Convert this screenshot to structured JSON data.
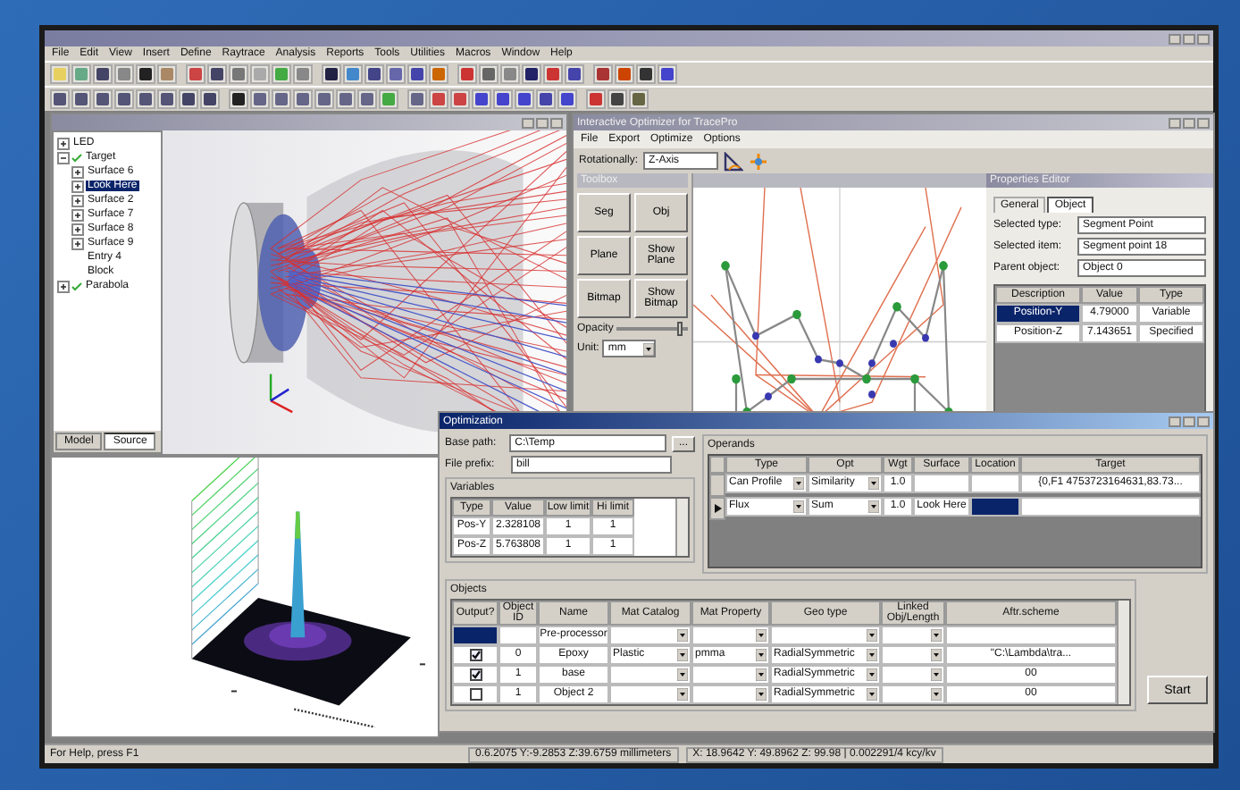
{
  "app": {
    "menu": [
      "File",
      "Edit",
      "View",
      "Insert",
      "Define",
      "Raytrace",
      "Analysis",
      "Reports",
      "Tools",
      "Utilities",
      "Macros",
      "Window",
      "Help"
    ]
  },
  "model_window": {
    "tree": [
      {
        "label": "LED",
        "expanded": false,
        "checked": false,
        "selected": false
      },
      {
        "label": "Target",
        "expanded": true,
        "checked": true,
        "selected": false,
        "children": [
          {
            "label": "Surface 6",
            "expanded": false,
            "selected": false
          },
          {
            "label": "Look Here",
            "expanded": false,
            "selected": true
          },
          {
            "label": "Surface 2",
            "expanded": false,
            "selected": false
          },
          {
            "label": "Surface 7",
            "expanded": false,
            "selected": false
          },
          {
            "label": "Surface 8",
            "expanded": false,
            "selected": false
          },
          {
            "label": "Surface 9",
            "expanded": false,
            "selected": false
          },
          {
            "label": "Entry 4",
            "selected": false
          },
          {
            "label": "Block",
            "selected": false
          }
        ]
      },
      {
        "label": "Parabola",
        "expanded": false,
        "checked": true,
        "selected": false
      }
    ],
    "tabs": [
      {
        "label": "Model",
        "selected": false
      },
      {
        "label": "Source",
        "selected": true
      }
    ]
  },
  "optimizer_window": {
    "title": "Interactive Optimizer for TracePro",
    "menu": [
      "File",
      "Export",
      "Optimize",
      "Options"
    ],
    "rotation": {
      "label": "Rotationally:",
      "value": "Z-Axis"
    },
    "toolbox": {
      "title": "Toolbox",
      "buttons": [
        "Seg",
        "Obj",
        "Plane",
        "Show Plane",
        "Bitmap",
        "Show Bitmap"
      ],
      "opacity": {
        "label": "Opacity",
        "level": 0.9
      },
      "unit": {
        "label": "Unit:",
        "value": "mm"
      }
    },
    "properties": {
      "title": "Properties Editor",
      "tabs": [
        {
          "label": "General",
          "selected": false
        },
        {
          "label": "Object",
          "selected": true
        }
      ],
      "fields": [
        {
          "label": "Selected type:",
          "value": "Segment Point"
        },
        {
          "label": "Selected item:",
          "value": "Segment point 18"
        },
        {
          "label": "Parent object:",
          "value": "Object 0"
        }
      ],
      "columns": [
        "Description",
        "Value",
        "Type"
      ],
      "rows": [
        {
          "cells": [
            "Position-Y",
            "4.79000",
            "Variable"
          ],
          "selected": true
        },
        {
          "cells": [
            "Position-Z",
            "7.143651",
            "Specified"
          ],
          "selected": false
        }
      ]
    }
  },
  "optimization_window": {
    "title": "Optimization",
    "base_path": {
      "label": "Base path:",
      "value": "C:\\Temp",
      "button": "..."
    },
    "file_prefix": {
      "label": "File prefix:",
      "value": "bill"
    },
    "variables": {
      "title": "Variables",
      "columns": [
        "Type",
        "Value",
        "Low limit",
        "Hi limit"
      ],
      "rows": [
        [
          "Pos-Y",
          "2.328108",
          "1",
          "1"
        ],
        [
          "Pos-Z",
          "5.763808",
          "1",
          "1"
        ]
      ]
    },
    "operands": {
      "title": "Operands",
      "columns": [
        "Type",
        "Opt",
        "Wgt",
        "Surface",
        "Location",
        "Target"
      ],
      "rows": [
        {
          "type": "Can Profile",
          "opt": "Similarity",
          "wgt": "1.0",
          "surface": "",
          "target": "{0,F1 4753723164631,83.73...",
          "selected": false
        },
        {
          "type": "Flux",
          "opt": "Sum",
          "wgt": "1.0",
          "surface": "Look Here",
          "target": "",
          "selected": true
        }
      ]
    },
    "objects": {
      "title": "Objects",
      "columns": [
        "Output?",
        "Object ID",
        "Name",
        "Mat Catalog",
        "Mat Property",
        "Geo type",
        "Linked Obj/Length",
        "Aftr.scheme"
      ],
      "rows": [
        {
          "selected": true,
          "id": "",
          "name": "Pre-processor",
          "catalog": "",
          "property": "",
          "geo": "",
          "after": ""
        },
        {
          "output": true,
          "selected": false,
          "id": "0",
          "name": "Epoxy",
          "catalog": "Plastic",
          "property": "pmma",
          "geo": "RadialSymmetric",
          "after": "\"C:\\Lambda\\tra..."
        },
        {
          "output": true,
          "selected": false,
          "id": "1",
          "name": "base",
          "catalog": "",
          "property": "",
          "geo": "RadialSymmetric",
          "after": "00"
        },
        {
          "output": false,
          "selected": false,
          "id": "1",
          "name": "Object 2",
          "catalog": "",
          "property": "",
          "geo": "RadialSymmetric",
          "after": "00"
        }
      ]
    },
    "start_button": "Start"
  },
  "status_bar": {
    "help": "For Help, press F1",
    "fields": [
      "0.6.2075 Y:-9.2853 Z:39.6759 millimeters",
      "X: 18.9642 Y: 49.8962 Z: 99.98 | 0.002291/4 kcy/kv"
    ]
  }
}
